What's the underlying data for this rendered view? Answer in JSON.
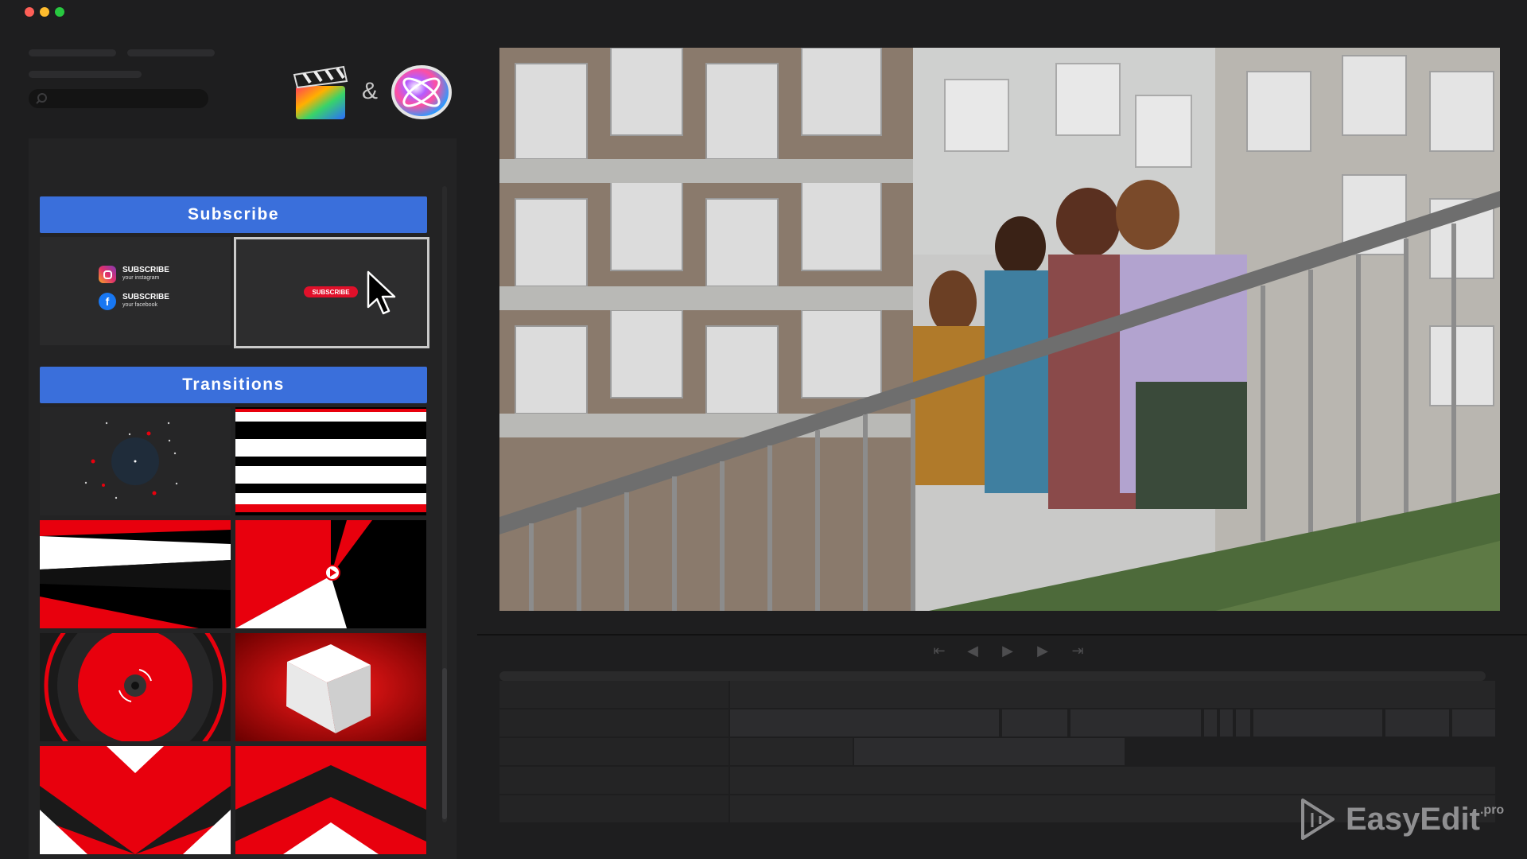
{
  "window": {
    "traffic_lights": [
      "#fe5f57",
      "#febc2e",
      "#28c840"
    ]
  },
  "toolbar": {
    "ampersand": "&",
    "apps": [
      "Final Cut Pro clapper icon",
      "Motion app icon"
    ]
  },
  "sidebar": {
    "categories": [
      {
        "title": "Subscribe",
        "thumbnails": [
          {
            "type": "social-subscribe",
            "rows": [
              {
                "icon": "instagram-icon",
                "title": "SUBSCRIBE",
                "subtitle": "your instagram"
              },
              {
                "icon": "facebook-icon",
                "title": "SUBSCRIBE",
                "subtitle": "your facebook"
              }
            ]
          },
          {
            "type": "subscribe-button",
            "button_label": "SUBSCRIBE",
            "selected": true
          }
        ]
      },
      {
        "title": "Transitions",
        "thumbnails": [
          {
            "type": "dot-circle"
          },
          {
            "type": "stripes"
          },
          {
            "type": "swoosh"
          },
          {
            "type": "play-shards"
          },
          {
            "type": "target-circle"
          },
          {
            "type": "cube"
          },
          {
            "type": "chevron-down"
          },
          {
            "type": "chevron-up"
          }
        ]
      }
    ]
  },
  "transport": {
    "controls": [
      "go-to-start-icon",
      "step-back-icon",
      "play-icon",
      "step-forward-icon",
      "go-to-end-icon"
    ]
  },
  "brand": {
    "name": "EasyEdit",
    "suffix": ".pro",
    "color": "#8f8f91"
  },
  "colors": {
    "accent_blue": "#3a6fdb",
    "transition_red": "#e8000d"
  }
}
